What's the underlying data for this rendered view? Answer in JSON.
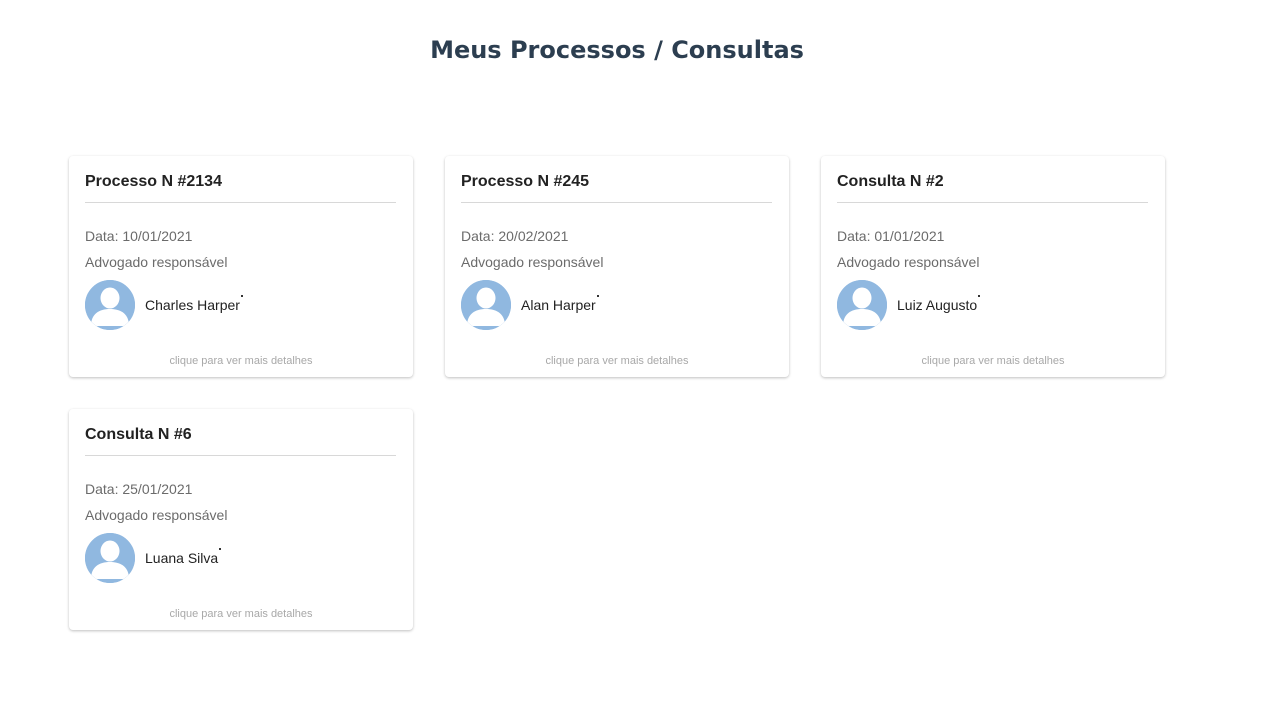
{
  "page": {
    "title": "Meus Processos / Consultas"
  },
  "cards": [
    {
      "title": "Processo N #2134",
      "date": "Data: 10/01/2021",
      "lawyer_label": "Advogado responsável",
      "lawyer_name": "Charles Harper",
      "hint": "clique para ver mais detalhes"
    },
    {
      "title": "Processo N #245",
      "date": "Data: 20/02/2021",
      "lawyer_label": "Advogado responsável",
      "lawyer_name": "Alan Harper",
      "hint": "clique para ver mais detalhes"
    },
    {
      "title": "Consulta N #2",
      "date": "Data: 01/01/2021",
      "lawyer_label": "Advogado responsável",
      "lawyer_name": "Luiz Augusto",
      "hint": "clique para ver mais detalhes"
    },
    {
      "title": "Consulta N #6",
      "date": "Data: 25/01/2021",
      "lawyer_label": "Advogado responsável",
      "lawyer_name": "Luana Silva",
      "hint": "clique para ver mais detalhes"
    }
  ],
  "icons": {
    "avatar": "user-avatar-icon"
  },
  "colors": {
    "title": "#2c3e50",
    "avatar_bg": "#90b8e0",
    "muted_text": "#6b6b6b",
    "hint_text": "#a8a8a8"
  }
}
